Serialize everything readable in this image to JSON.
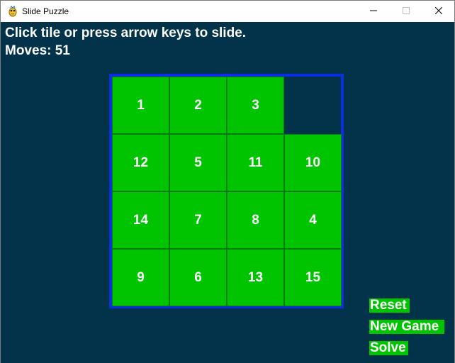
{
  "window": {
    "title": "Slide Puzzle",
    "controls": {
      "minimize_icon": "minimize-icon",
      "maximize_icon": "maximize-icon",
      "close_icon": "close-icon"
    }
  },
  "game": {
    "instruction": "Click tile or press arrow keys to slide.",
    "moves_label": "Moves: 51",
    "board": {
      "rows": 4,
      "cols": 4,
      "tiles": [
        [
          "1",
          "2",
          "3",
          ""
        ],
        [
          "12",
          "5",
          "11",
          "10"
        ],
        [
          "14",
          "7",
          "8",
          "4"
        ],
        [
          "9",
          "6",
          "13",
          "15"
        ]
      ]
    },
    "buttons": {
      "reset": "Reset",
      "new_game": "New Game",
      "solve": "Solve"
    }
  },
  "colors": {
    "background": "#02334a",
    "tile": "#00c400",
    "tile_border": "#047a14",
    "board_border": "#0a2fe0",
    "text": "#ffffff"
  }
}
